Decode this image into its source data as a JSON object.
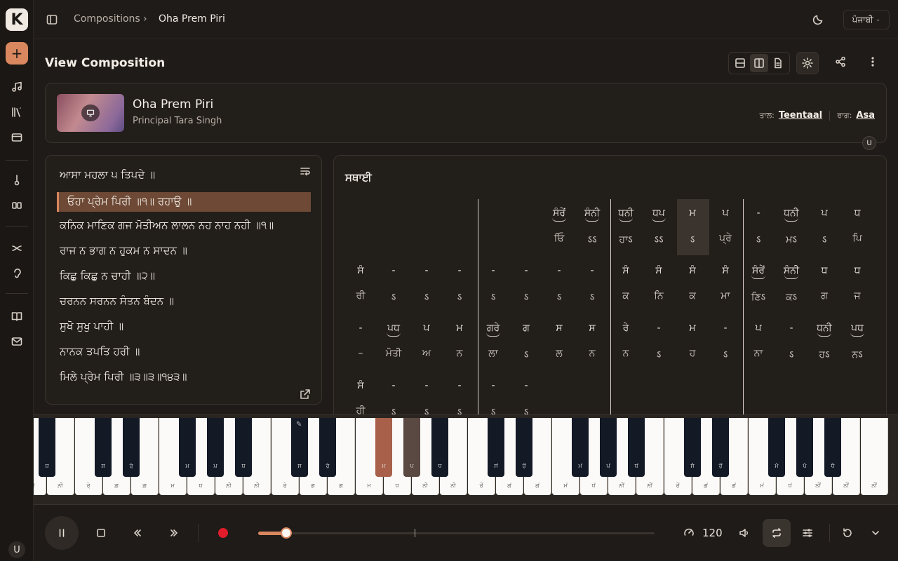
{
  "app": {
    "logo": "K",
    "new_label": "+",
    "avatar": "U"
  },
  "topbar": {
    "crumb_root": "Compositions",
    "crumb_sep": "›",
    "crumb_current": "Oha Prem Piri",
    "lang": "ਪੰਜਾਬੀ"
  },
  "page": {
    "title": "View Composition"
  },
  "composition": {
    "name": "Oha Prem Piri",
    "artist": "Principal Tara Singh",
    "tala_label": "ਤਾਲ:",
    "tala": "Teentaal",
    "raga_label": "ਰਾਗ:",
    "raga": "Asa",
    "user_chip": "U"
  },
  "lyrics": [
    "ਆਸਾ ਮਹਲਾ ੫ ਤਿਪਦੇ ॥",
    "ਓਹਾ ਪ੍ਰੇਮ ਪਿਰੀ ॥੧॥ ਰਹਾਉ ॥",
    "ਕਨਿਕ ਮਾਣਿਕ ਗਜ ਮੋਤੀਅਨ ਲਾਲਨ ਨਹ ਨਾਹ ਨਹੀ ॥੧॥",
    "ਰਾਜ ਨ ਭਾਗ ਨ ਹੁਕਮ ਨ ਸਾਦਨ ॥",
    "ਕਿਛੁ ਕਿਛੁ ਨ ਚਾਹੀ ॥੨॥",
    "ਚਰਨਨ ਸਰਨਨ ਸੰਤਨ ਬੰਦਨ ॥",
    "ਸੁਖੋ ਸੁਖੁ ਪਾਹੀ ॥",
    "ਨਾਨਕ ਤਪਤਿ ਹਰੀ ॥",
    "ਮਿਲੇ ਪ੍ਰੇਮ ਪਿਰੀ ॥੩॥੩॥੧੪੩॥"
  ],
  "notation": {
    "section": "ਸਥਾਈ",
    "rows": [
      {
        "notes": [
          "",
          "",
          "",
          "",
          "",
          "",
          "ਸੰਰੇਂ",
          "ਸੰਨੀ",
          "ਧਨੀ",
          "ਧਪ",
          "ਮ",
          "ਪ",
          "-",
          "ਧਨੀ",
          "ਪ",
          "ਧ"
        ],
        "lyrics": [
          "",
          "",
          "",
          "",
          "",
          "",
          "ਓਿ",
          "ऽऽ",
          "ਹਾऽ",
          "ऽऽ",
          "ऽ",
          "ਪ੍ਰੇ",
          "ऽ",
          "ਮऽ",
          "ऽ",
          "ਪਿ"
        ]
      },
      {
        "notes": [
          "ਸੰ",
          "-",
          "-",
          "-",
          "-",
          "-",
          "-",
          "-",
          "ਸੰ",
          "ਸੰ",
          "ਸੰ",
          "ਸੰ",
          "ਸੰਰੇਂ",
          "ਸੰਨੀ",
          "ਧ",
          "ਧ"
        ],
        "lyrics": [
          "ਰੀ",
          "ऽ",
          "ऽ",
          "ऽ",
          "ऽ",
          "ऽ",
          "ऽ",
          "ऽ",
          "ਕ",
          "ਨਿ",
          "ਕ",
          "ਮਾ",
          "ਣਿऽ",
          "ਕऽ",
          "ਗ",
          "ਜ"
        ]
      },
      {
        "notes": [
          "-",
          "ਪਧ",
          "ਪ",
          "ਮ",
          "ਗਰੇ",
          "ਗ",
          "ਸ",
          "ਸ",
          "ਰੇ",
          "-",
          "ਮ",
          "-",
          "ਪ",
          "-",
          "ਧਨੀ",
          "ਪਧ"
        ],
        "lyrics": [
          "–",
          "ਮੋਤੀ",
          "ਅ",
          "ਨ",
          "ਲਾ",
          "ऽ",
          "ਲ",
          "ਨ",
          "ਨ",
          "ऽ",
          "ਹ",
          "ऽ",
          "ਨਾ",
          "ऽ",
          "ਹऽ",
          "ਨऽ"
        ]
      },
      {
        "notes": [
          "ਸੰ",
          "-",
          "-",
          "-",
          "-",
          "-",
          "",
          "",
          "",
          "",
          "",
          "",
          "",
          "",
          "",
          ""
        ],
        "lyrics": [
          "ਹੀ",
          "ऽ",
          "ऽ",
          "ऽ",
          "ऽ",
          "ऽ",
          "",
          "",
          "",
          "",
          "",
          "",
          "",
          "",
          "",
          ""
        ]
      }
    ]
  },
  "piano": {
    "white": [
      "ਨ਼ੀ",
      "ਨ਼ੀ",
      "ਰੇ਼",
      "ਗ਼",
      "ਗ਼",
      "ਮ਼",
      "ਧ਼",
      "ਨ਼ੀ",
      "ਨ਼ੀ",
      "ਰੇ",
      "ਗ",
      "ਗ",
      "ਮ",
      "ਧ",
      "ਨੀ",
      "ਨੀ",
      "ਰੇਂ",
      "ਗਂ",
      "ਗਂ",
      "ਮਂ",
      "ਧਂ",
      "ਨੀਂ",
      "ਨੀਂ",
      "ਰੇਂ",
      "ਗਂ",
      "ਗਂ",
      "ਮਂ",
      "ਧਂ",
      "ਨੀਂ",
      "ਨੀਂ",
      "ਨੀਂ"
    ],
    "black": [
      "ਧ਼",
      "ਸ਼",
      "ਰੇ਼",
      "ਮ਼",
      "ਪ਼",
      "ਧ਼",
      "ਸ",
      "ਰੇ",
      "ਮ",
      "ਪ",
      "ਧ",
      "ਸਂ",
      "ਰੇਂ",
      "ਮਂ",
      "ਪਂ",
      "ਧਂ",
      "ਸੰ",
      "ਰੇਂ",
      "ਮੰ",
      "ਪੰ",
      "ਧੰ"
    ]
  },
  "player": {
    "bpm": "120",
    "progress": 0.07
  }
}
